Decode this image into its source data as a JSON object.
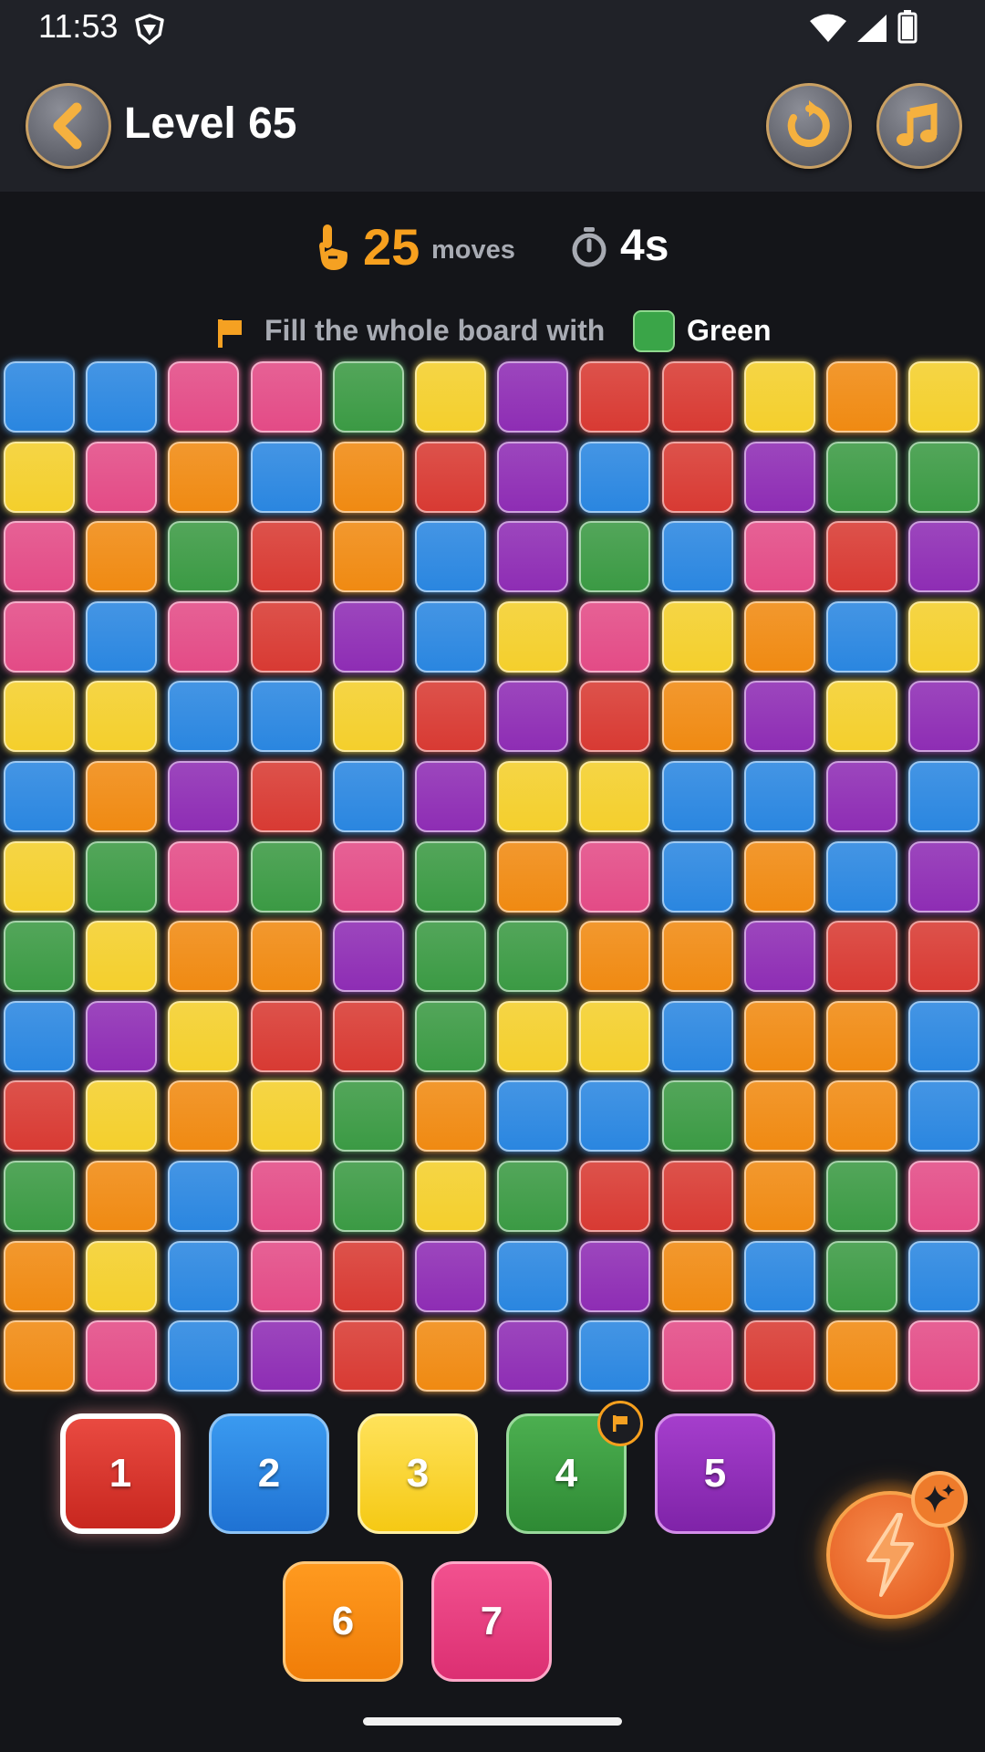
{
  "status_bar": {
    "time": "11:53"
  },
  "header": {
    "level_title": "Level 65"
  },
  "stats": {
    "moves_count": "25",
    "moves_label": "moves",
    "timer": "4s"
  },
  "goal": {
    "text": "Fill the whole board with",
    "target_color_name": "Green",
    "target_color": "#3aa548"
  },
  "colors": {
    "R": "#d83a33",
    "B": "#2a86e0",
    "K": "#e34b86",
    "G": "#3b9a44",
    "Y": "#f4cf2c",
    "P": "#8e2db4",
    "O": "#f08a12"
  },
  "board": [
    "BBKKGYPRRYOY",
    "YKOBORPBRPGG",
    "KOGROBPGBKRP",
    "KBKRPBYKYOBY",
    "YYBBYRPROPYP",
    "BOPRBPYYBBPB",
    "YGKGKGOKBOBP",
    "GYOOPGGOOPRR",
    "BPYRRGYYBOOB",
    "RYOYGOBBGOOB",
    "GOBKGYGRROGK",
    "OYBKRPBPOBGB",
    "OKBPROPBKROK"
  ],
  "palette": [
    {
      "number": "1",
      "color": "red"
    },
    {
      "number": "2",
      "color": "blue"
    },
    {
      "number": "3",
      "color": "yellow"
    },
    {
      "number": "4",
      "color": "green"
    },
    {
      "number": "5",
      "color": "purple"
    },
    {
      "number": "6",
      "color": "orange"
    },
    {
      "number": "7",
      "color": "pink"
    }
  ],
  "selected_palette": "1",
  "target_palette": "4",
  "icons": {
    "back": "chevron-left-icon",
    "restart": "restart-icon",
    "music": "music-note-icon",
    "moves": "hand-pointer-icon",
    "timer": "stopwatch-icon",
    "goal": "flag-icon",
    "power": "lightning-icon",
    "sparkle": "sparkle-icon"
  }
}
